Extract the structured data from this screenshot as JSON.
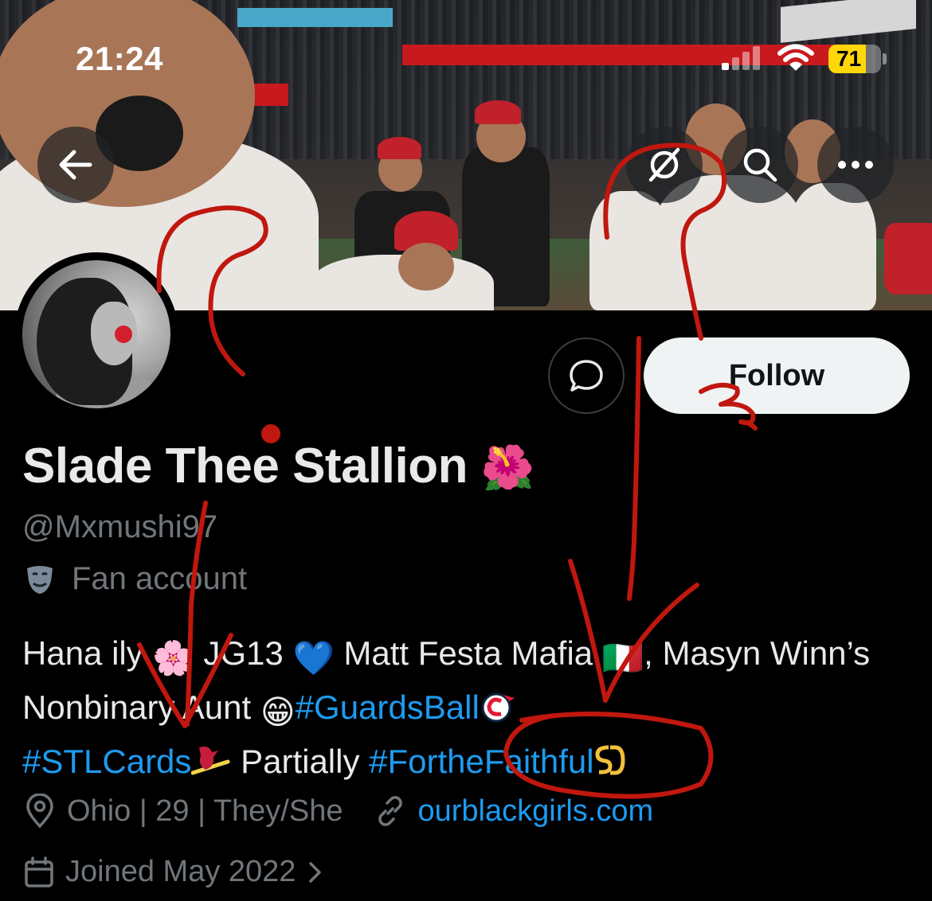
{
  "status_bar": {
    "time": "21:24",
    "battery_level": "71",
    "battery_fraction": 0.71,
    "signal_bars_active": 1,
    "signal_bars_total": 4,
    "battery_color": "#ffd60a"
  },
  "header": {
    "back_icon": "arrow-left-icon",
    "grok_icon": "grok-icon",
    "search_icon": "search-icon",
    "more_icon": "more-horizontal-icon"
  },
  "profile": {
    "display_name": "Slade Thee Stallion",
    "name_emoji": "🌺",
    "handle": "@Mxmushi97",
    "account_type_icon": "performing-arts-icon",
    "account_type": "Fan account",
    "message_icon": "message-bubble-icon",
    "follow_label": "Follow",
    "bio": {
      "t1": "Hana ily ",
      "e1": "🌸",
      "t2": " JG13 ",
      "e2": "💙",
      "t3": " Matt Festa Mafia ",
      "e3": "🇮🇹",
      "t4": ", Masyn Winn’s Nonbinary Aunt ",
      "e4": "😁",
      "tag1": "#GuardsBall",
      "logo1": "cleveland-guardians-logo",
      "tag2": "#STLCards",
      "logo2": "st-louis-cardinals-logo",
      "t5": " Partially ",
      "tag3": "#FortheFaithful",
      "logo3": "san-diego-padres-logo"
    },
    "location_icon": "location-pin-icon",
    "location": "Ohio | 29 | They/She",
    "link_icon": "link-icon",
    "website": "ourblackgirls.com",
    "calendar_icon": "calendar-icon",
    "joined": "Joined May 2022",
    "joined_chevron": "chevron-right-icon"
  },
  "colors": {
    "accent": "#1d9bf0",
    "muted_text": "#71767b",
    "annotation_red": "#c0170f"
  }
}
